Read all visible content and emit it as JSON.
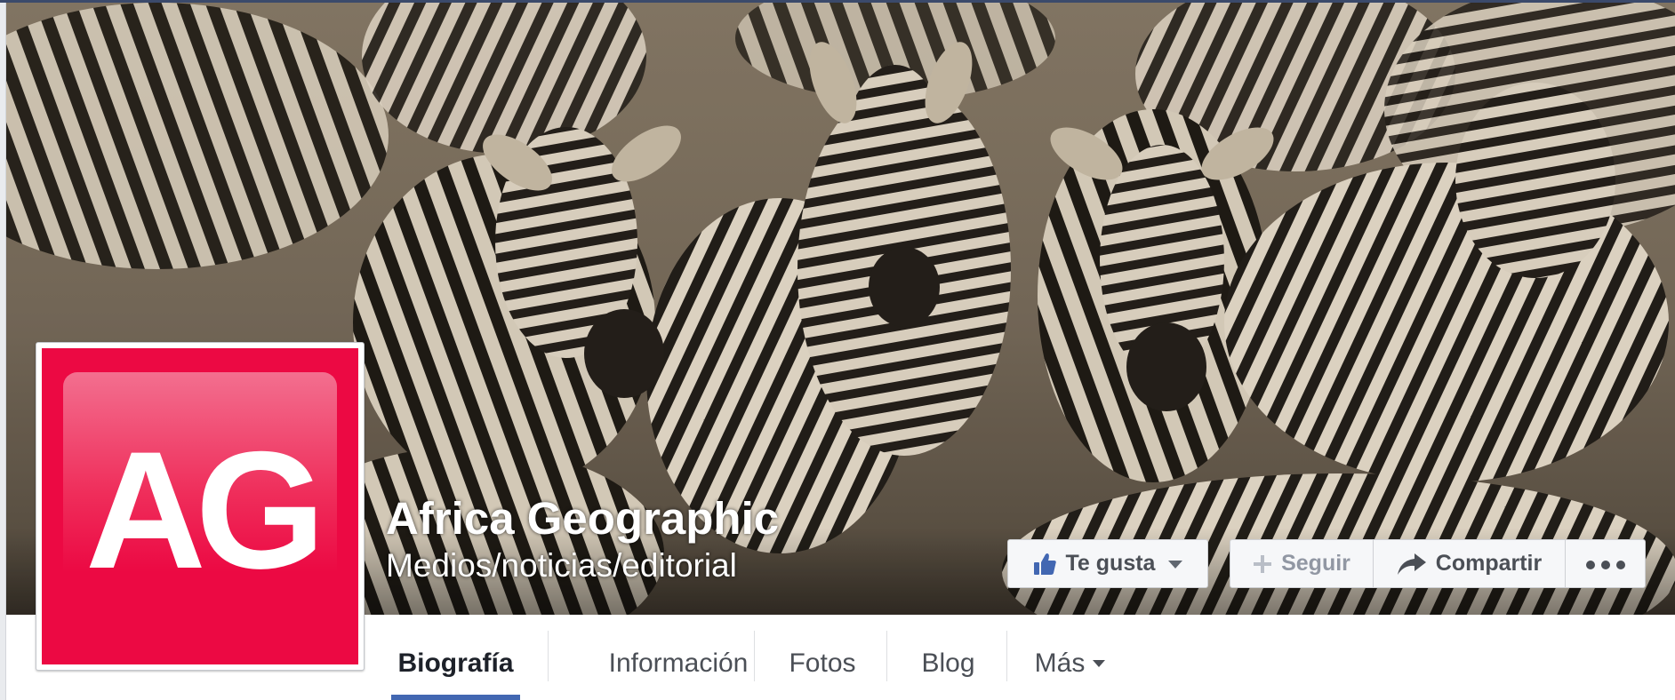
{
  "page": {
    "title": "Africa Geographic",
    "category": "Medios/noticias/editorial",
    "avatar_logo_text": "AG",
    "brand_color": "#ec0943"
  },
  "actions": {
    "like_label": "Te gusta",
    "follow_label": "Seguir",
    "share_label": "Compartir",
    "more_icon": "ellipsis-icon"
  },
  "tabs": [
    {
      "label": "Biografía",
      "active": true
    },
    {
      "label": "Información",
      "active": false
    },
    {
      "label": "Fotos",
      "active": false
    },
    {
      "label": "Blog",
      "active": false
    },
    {
      "label": "Más",
      "active": false
    }
  ],
  "colors": {
    "tab_underline": "#4267b2",
    "like_icon": "#4267b2"
  }
}
